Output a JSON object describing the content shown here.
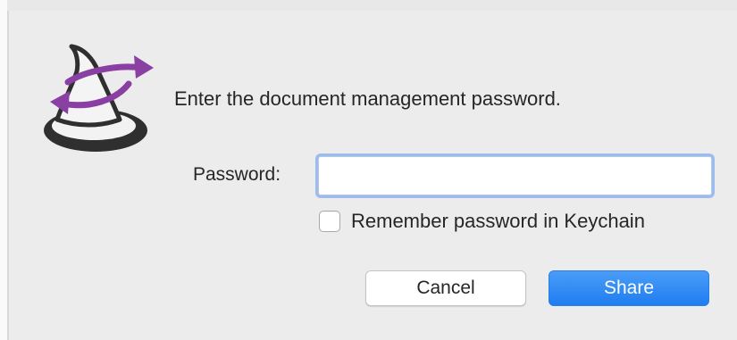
{
  "dialog": {
    "message": "Enter the document management password.",
    "app_icon": "wizard-hat-sync-icon"
  },
  "password": {
    "label": "Password:",
    "value": "",
    "placeholder": ""
  },
  "remember": {
    "label": "Remember password in Keychain",
    "checked": false
  },
  "buttons": {
    "cancel": "Cancel",
    "share": "Share"
  },
  "colors": {
    "accent": "#1f7df0",
    "dialog_background": "#ececec",
    "icon_purple": "#8a3fa3",
    "icon_dark": "#2f2f2f"
  }
}
